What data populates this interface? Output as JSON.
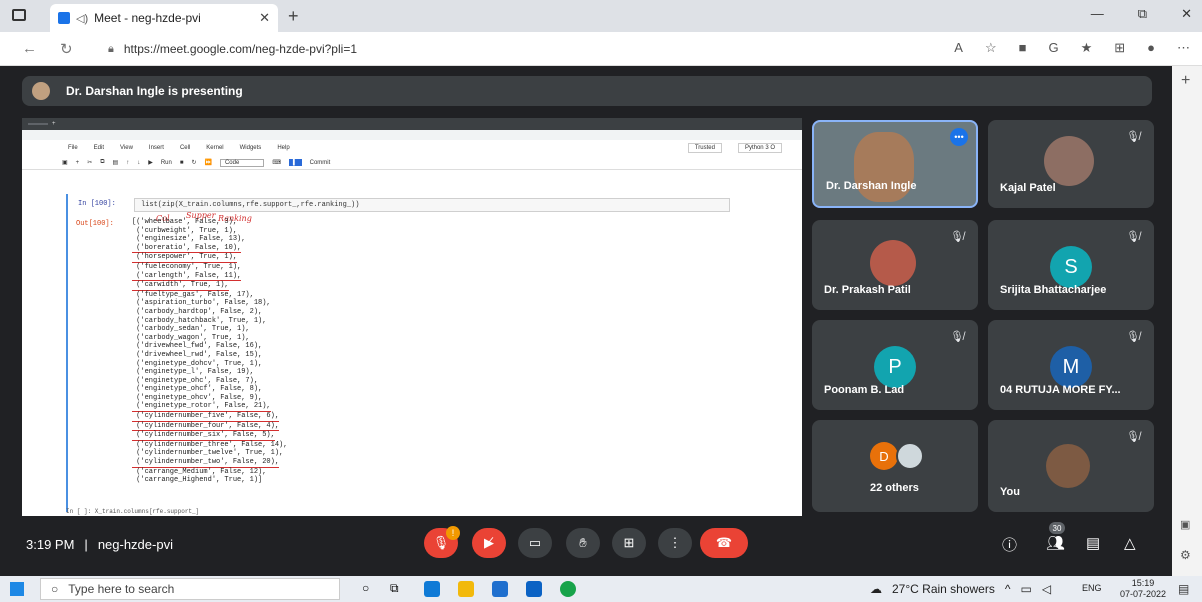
{
  "browser": {
    "tab_title": "Meet - neg-hzde-pvi",
    "tab_close": "✕",
    "new_tab": "+",
    "url": "https://meet.google.com/neg-hzde-pvi?pli=1",
    "window_buttons": [
      "—",
      "⧉",
      "✕"
    ]
  },
  "meet": {
    "presenting_text": "Dr. Darshan Ingle is presenting",
    "time": "3:19 PM",
    "separator": "|",
    "meeting_code": "neg-hzde-pvi",
    "mic_badge": "!",
    "participant_count": "30"
  },
  "shared_screen": {
    "menu": [
      "File",
      "Edit",
      "View",
      "Insert",
      "Cell",
      "Kernel",
      "Widgets",
      "Help"
    ],
    "trusted": "Trusted",
    "kernel": "Python 3 O",
    "run_label": "Run",
    "cell_type": "Code",
    "commit_label": "Commit",
    "in_label": "In [100]:",
    "code": "list(zip(X_train.columns,rfe.support_,rfe.ranking_))",
    "out_label": "Out[100]:",
    "annotations": {
      "col": "Col",
      "support": "Supper",
      "ranking": "Ranking"
    },
    "output_lines": [
      "[('wheelbase', False, 3),",
      " ('curbweight', True, 1),",
      " ('enginesize', False, 13),",
      " ('boreratio', False, 10),",
      " ('horsepower', True, 1),",
      " ('fueleconomy', True, 1),",
      " ('carlength', False, 11),",
      " ('carwidth', True, 1),",
      " ('fueltype_gas', False, 17),",
      " ('aspiration_turbo', False, 18),",
      " ('carbody_hardtop', False, 2),",
      " ('carbody_hatchback', True, 1),",
      " ('carbody_sedan', True, 1),",
      " ('carbody_wagon', True, 1),",
      " ('drivewheel_fwd', False, 16),",
      " ('drivewheel_rwd', False, 15),",
      " ('enginetype_dohcv', True, 1),",
      " ('enginetype_l', False, 19),",
      " ('enginetype_ohc', False, 7),",
      " ('enginetype_ohcf', False, 8),",
      " ('enginetype_ohcv', False, 9),",
      " ('enginetype_rotor', False, 21),",
      " ('cylindernumber_five', False, 6),",
      " ('cylindernumber_four', False, 4),",
      " ('cylindernumber_six', False, 5),",
      " ('cylindernumber_three', False, 14),",
      " ('cylindernumber_twelve', True, 1),",
      " ('cylindernumber_two', False, 20),",
      " ('carrange_Medium', False, 12),",
      " ('carrange_Highend', True, 1)]"
    ],
    "next_cell": "In [ ]: X_train.columns[rfe.support_]"
  },
  "participants": [
    {
      "name": "Dr. Darshan Ingle",
      "type": "video"
    },
    {
      "name": "Kajal Patel",
      "type": "photo"
    },
    {
      "name": "Dr. Prakash Patil",
      "type": "photo"
    },
    {
      "name": "Srijita Bhattacharjee",
      "type": "initial",
      "initial": "S",
      "color": "#12a4af"
    },
    {
      "name": "Poonam B. Lad",
      "type": "initial",
      "initial": "P",
      "color": "#12a4af"
    },
    {
      "name": "04 RUTUJA MORE FY...",
      "type": "initial",
      "initial": "M",
      "color": "#1e5fa6"
    },
    {
      "name": "22 others",
      "type": "group",
      "initial": "D",
      "color": "#e8710a"
    },
    {
      "name": "You",
      "type": "photo"
    }
  ],
  "taskbar": {
    "search_placeholder": "Type here to search",
    "weather": "27°C  Rain showers",
    "lang": "ENG",
    "time": "15:19",
    "date": "07-07-2022"
  }
}
